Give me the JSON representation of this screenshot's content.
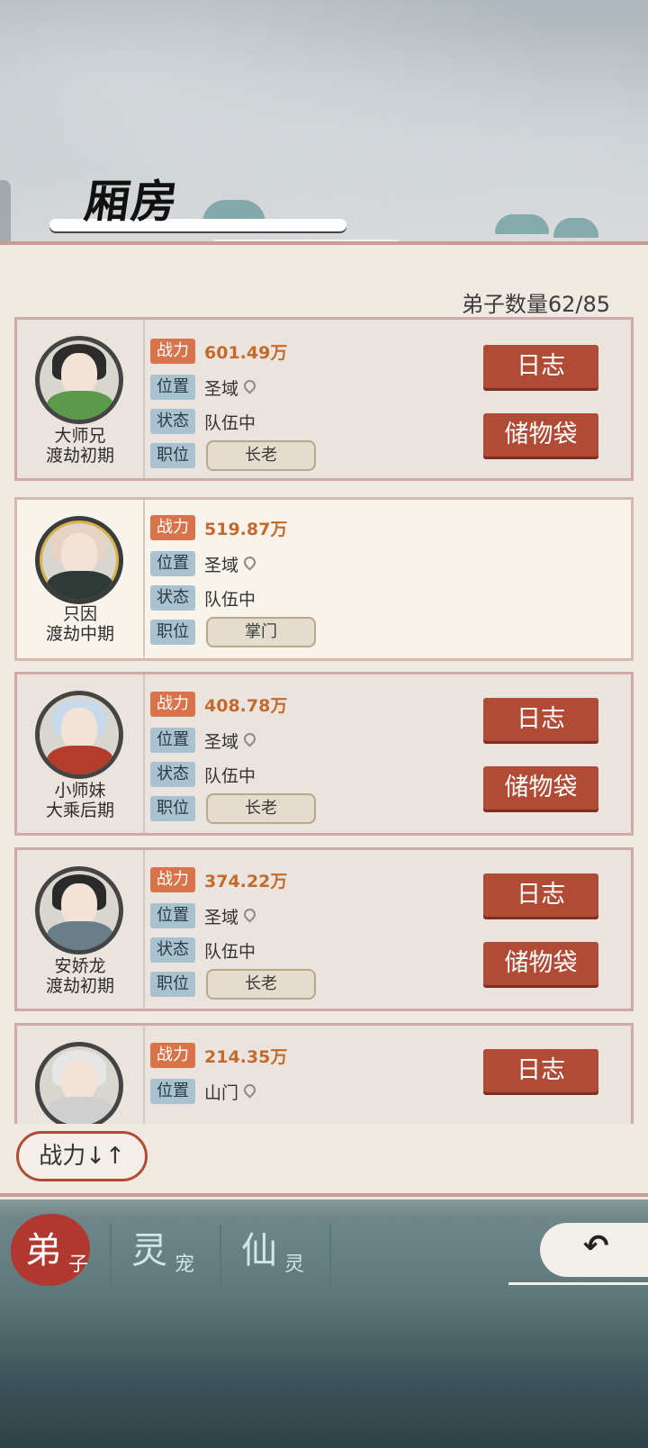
{
  "header": {
    "title": "厢房"
  },
  "disciple_count_text": "弟子数量62/85",
  "labels": {
    "power": "战力",
    "location": "位置",
    "status": "状态",
    "position": "职位"
  },
  "disciples": [
    {
      "name": "大师兄",
      "realm": "渡劫初期",
      "power": "601.49万",
      "location": "圣域",
      "status": "队伍中",
      "role": "长老",
      "log_label": "日志",
      "bag_label": "储物袋",
      "colors": {
        "hair": "#2c2c2c",
        "robe": "#5b9a4a"
      }
    },
    {
      "name": "只因",
      "realm": "渡劫中期",
      "power": "519.87万",
      "location": "圣域",
      "status": "队伍中",
      "role": "掌门",
      "colors": {
        "hair": "#e8d2c4",
        "robe": "#2f3a36"
      }
    },
    {
      "name": "小师妹",
      "realm": "大乘后期",
      "power": "408.78万",
      "location": "圣域",
      "status": "队伍中",
      "role": "长老",
      "log_label": "日志",
      "bag_label": "储物袋",
      "colors": {
        "hair": "#c7d9ea",
        "robe": "#b43c2a"
      }
    },
    {
      "name": "安娇龙",
      "realm": "渡劫初期",
      "power": "374.22万",
      "location": "圣域",
      "status": "队伍中",
      "role": "长老",
      "log_label": "日志",
      "bag_label": "储物袋",
      "colors": {
        "hair": "#2a2a2a",
        "robe": "#6a7d8a"
      }
    },
    {
      "name": "",
      "realm": "",
      "power": "214.35万",
      "location": "山门",
      "status": "",
      "role": "",
      "log_label": "日志",
      "colors": {
        "hair": "#e6e6e6",
        "robe": "#cfcfcf"
      }
    }
  ],
  "sort_button": "战力↓↑",
  "nav": [
    {
      "main": "弟",
      "sub": "子",
      "active": true
    },
    {
      "main": "灵",
      "sub": "宠"
    },
    {
      "main": "仙",
      "sub": "灵"
    }
  ],
  "back_icon": "back-arrow-icon"
}
